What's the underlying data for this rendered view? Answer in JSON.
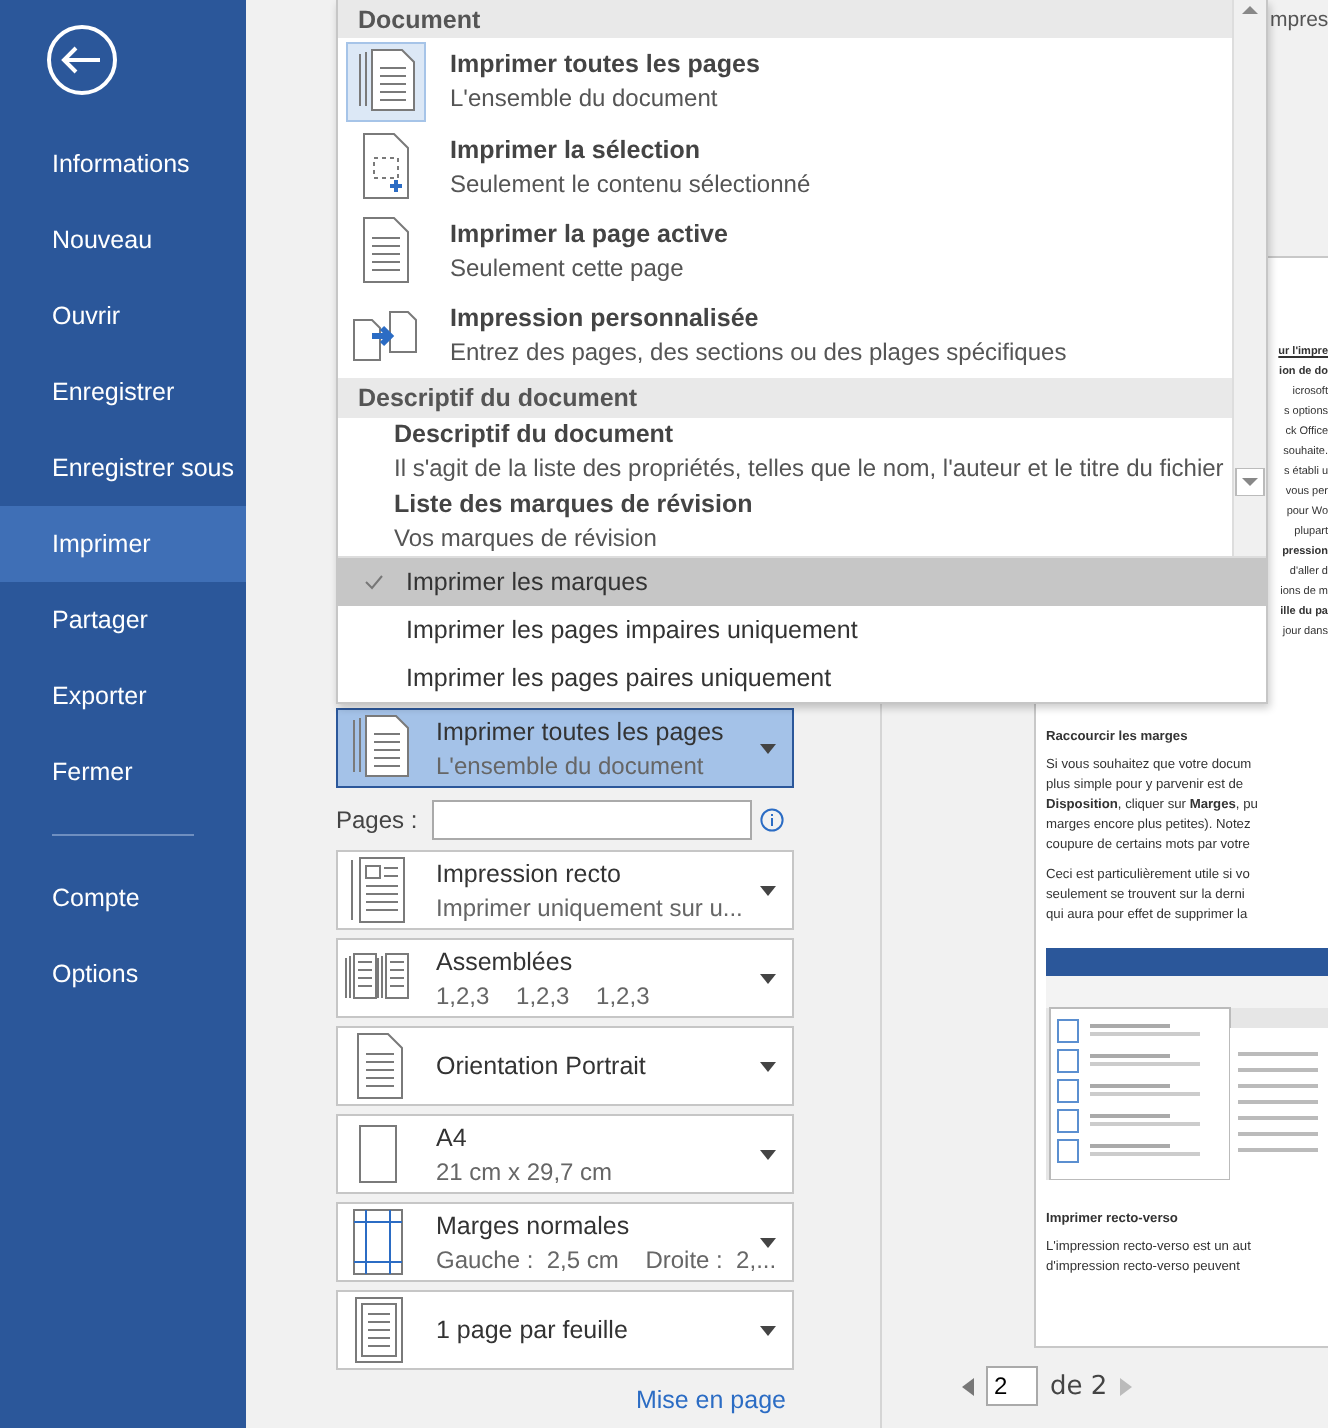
{
  "sidebar": {
    "items": [
      {
        "label": "Informations",
        "selected": false
      },
      {
        "label": "Nouveau",
        "selected": false
      },
      {
        "label": "Ouvrir",
        "selected": false
      },
      {
        "label": "Enregistrer",
        "selected": false
      },
      {
        "label": "Enregistrer sous",
        "selected": false
      },
      {
        "label": "Imprimer",
        "selected": true
      },
      {
        "label": "Partager",
        "selected": false
      },
      {
        "label": "Exporter",
        "selected": false
      },
      {
        "label": "Fermer",
        "selected": false
      }
    ],
    "bottom_items": [
      {
        "label": "Compte",
        "selected": false
      },
      {
        "label": "Options",
        "selected": false
      }
    ]
  },
  "print_menu": {
    "sections": [
      {
        "header": "Document",
        "items": [
          {
            "kind": "all",
            "title": "Imprimer toutes les pages",
            "description": "L'ensemble du document",
            "selected": true
          },
          {
            "kind": "selection",
            "title": "Imprimer la sélection",
            "description": "Seulement le contenu sélectionné",
            "selected": false
          },
          {
            "kind": "current",
            "title": "Imprimer la page active",
            "description": "Seulement cette page",
            "selected": false
          },
          {
            "kind": "custom",
            "title": "Impression personnalisée",
            "description": "Entrez des pages, des sections ou des plages spécifiques",
            "selected": false
          }
        ]
      },
      {
        "header": "Descriptif du document",
        "items": [
          {
            "kind": "text",
            "title": "Descriptif du document",
            "description": "Il s'agit de la liste des propriétés, telles que le nom, l'auteur et le titre du fichier"
          },
          {
            "kind": "text",
            "title": "Liste des marques de révision",
            "description": "Vos marques de révision"
          }
        ]
      }
    ],
    "options": [
      {
        "label": "Imprimer les marques",
        "checked": true,
        "highlighted": true
      },
      {
        "label": "Imprimer les pages impaires uniquement",
        "checked": false,
        "highlighted": false
      },
      {
        "label": "Imprimer les pages paires uniquement",
        "checked": false,
        "highlighted": false
      }
    ]
  },
  "settings": {
    "range": {
      "kind": "all",
      "title": "Imprimer toutes les pages",
      "subtitle": "L'ensemble du document",
      "selected": true
    },
    "pages_label": "Pages :",
    "dropdowns": [
      {
        "kind": "recto",
        "title": "Impression recto",
        "subtitle": "Imprimer uniquement sur u..."
      },
      {
        "kind": "collate",
        "title": "Assemblées",
        "subtitle": "1,2,3    1,2,3    1,2,3"
      },
      {
        "kind": "portrait",
        "title": "Orientation Portrait"
      },
      {
        "kind": "paper",
        "title": "A4",
        "subtitle": "21 cm x 29,7 cm"
      },
      {
        "kind": "margins",
        "title": "Marges normales",
        "subtitle": "Gauche :  2,5 cm    Droite :  2,..."
      },
      {
        "kind": "sheet",
        "title": "1 page par feuille"
      }
    ],
    "page_setup_link": "Mise en page"
  },
  "preview": {
    "header": "mpres",
    "fragments": [
      {
        "text": "ur l'impre",
        "kind": "heading"
      },
      {
        "text": "ion de do",
        "kind": "bold"
      },
      {
        "text": "icrosoft",
        "kind": "plain"
      },
      {
        "text": "s options",
        "kind": "plain"
      },
      {
        "text": "ck Office",
        "kind": "plain"
      },
      {
        "text": "souhaite.",
        "kind": "plain"
      },
      {
        "text": "s établi u",
        "kind": "plain"
      },
      {
        "text": "vous per",
        "kind": "plain"
      },
      {
        "text": "pour Wo",
        "kind": "plain"
      },
      {
        "text": "plupart",
        "kind": "plain"
      },
      {
        "text": "pression",
        "kind": "bold"
      },
      {
        "text": "d'aller d",
        "kind": "plain"
      },
      {
        "text": "ions de m",
        "kind": "plain"
      },
      {
        "text": "ille du pa",
        "kind": "bold"
      },
      {
        "text": "jour dans",
        "kind": "plain"
      }
    ],
    "blocks": [
      {
        "kind": "heading",
        "text": "Raccourcir les marges"
      },
      {
        "kind": "para",
        "lines": [
          "Si vous souhaitez que votre docum",
          "plus simple pour y parvenir est de",
          "**Disposition**, cliquer sur **Marges**, pu",
          "marges encore plus petites). Notez",
          "coupure de certains mots par votre"
        ]
      },
      {
        "kind": "para",
        "lines": [
          "Ceci est particulièrement utile si vo",
          "seulement se trouvent sur la derni",
          "qui aura pour effet de supprimer la"
        ]
      },
      {
        "kind": "image"
      },
      {
        "kind": "heading",
        "text": "Imprimer recto-verso"
      },
      {
        "kind": "para",
        "lines": [
          "L'impression recto-verso est un aut",
          "d'impression recto-verso peuvent"
        ]
      }
    ],
    "page_number": "2",
    "page_total": "de 2"
  }
}
